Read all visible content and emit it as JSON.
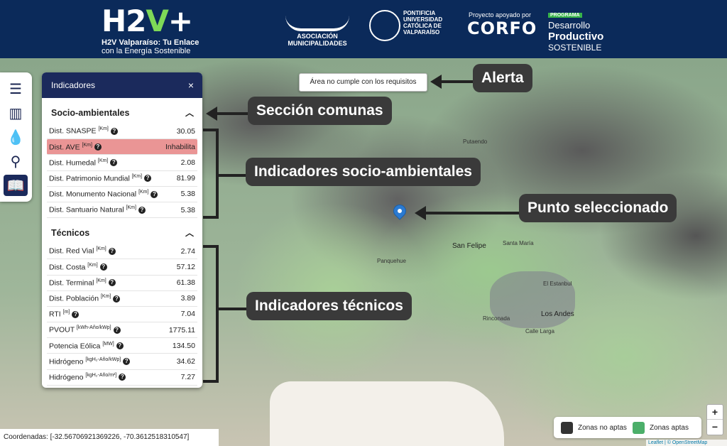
{
  "header": {
    "logo": "H2V+",
    "subtitle_1": "H2V Valparaíso: Tu Enlace",
    "subtitle_2": "con la Energía Sostenible",
    "partners": {
      "municipalidades": "ASOCIACIÓN MUNICIPALIDADES",
      "pucv": "PONTIFICIA UNIVERSIDAD CATÓLICA DE VALPARAÍSO",
      "corfo_small": "Proyecto apoyado por",
      "corfo": "CORFO",
      "programa": "PROGRAMA",
      "programa_l1": "Desarrollo",
      "programa_l2": "Productivo",
      "programa_l3": "SOSTENIBLE"
    }
  },
  "map": {
    "alert": "Área no cumple con los requisitos",
    "places": [
      "Putaendo",
      "San Felipe",
      "Santa María",
      "Panquehue",
      "El Estanbul",
      "Los Andes",
      "Calle Larga",
      "Rinconada"
    ]
  },
  "callouts": {
    "alerta": "Alerta",
    "seccion": "Sección comunas",
    "socio": "Indicadores socio-ambientales",
    "punto": "Punto seleccionado",
    "tecnicos": "Indicadores técnicos"
  },
  "toolbar": [
    "sliders-icon",
    "bar-chart-icon",
    "drop-icon",
    "search-zoom-icon",
    "book-icon"
  ],
  "panel": {
    "title": "Indicadores",
    "close": "×",
    "socio_title": "Socio-ambientales",
    "socio": [
      {
        "name": "Dist. SNASPE",
        "unit": "[Km]",
        "value": "30.05"
      },
      {
        "name": "Dist. AVE",
        "unit": "[Km]",
        "value": "Inhabilita"
      },
      {
        "name": "Dist. Humedal",
        "unit": "[Km]",
        "value": "2.08"
      },
      {
        "name": "Dist. Patrimonio Mundial",
        "unit": "[Km]",
        "value": "81.99"
      },
      {
        "name": "Dist. Monumento Nacional",
        "unit": "[Km]",
        "value": "5.38"
      },
      {
        "name": "Dist. Santuario Natural",
        "unit": "[Km]",
        "value": "5.38"
      }
    ],
    "tecnicos_title": "Técnicos",
    "tecnicos": [
      {
        "name": "Dist. Red Vial",
        "unit": "[Km]",
        "value": "2.74"
      },
      {
        "name": "Dist. Costa",
        "unit": "[Km]",
        "value": "57.12"
      },
      {
        "name": "Dist. Terminal",
        "unit": "[Km]",
        "value": "61.38"
      },
      {
        "name": "Dist. Población",
        "unit": "[Km]",
        "value": "3.89"
      },
      {
        "name": "RTI",
        "unit": "[m]",
        "value": "7.04"
      },
      {
        "name": "PVOUT",
        "unit": "[kWh-Año/kWp]",
        "value": "1775.11"
      },
      {
        "name": "Potencia Eólica",
        "unit": "[MW]",
        "value": "134.50"
      },
      {
        "name": "Hidrógeno",
        "unit": "[kgH₂-Año/kWp]",
        "value": "34.62"
      },
      {
        "name": "Hidrógeno",
        "unit": "[kgH₂-Año/m²]",
        "value": "7.27"
      }
    ]
  },
  "footer": {
    "coords": "Coordenadas: [-32.56706921369226, -70.3612518310547]",
    "legend_no": "Zonas no aptas",
    "legend_yes": "Zonas aptas",
    "color_no": "#333333",
    "color_yes": "#4caf6a",
    "zoom_in": "+",
    "zoom_out": "−",
    "attribution": "Leaflet | © OpenStreetMap"
  }
}
